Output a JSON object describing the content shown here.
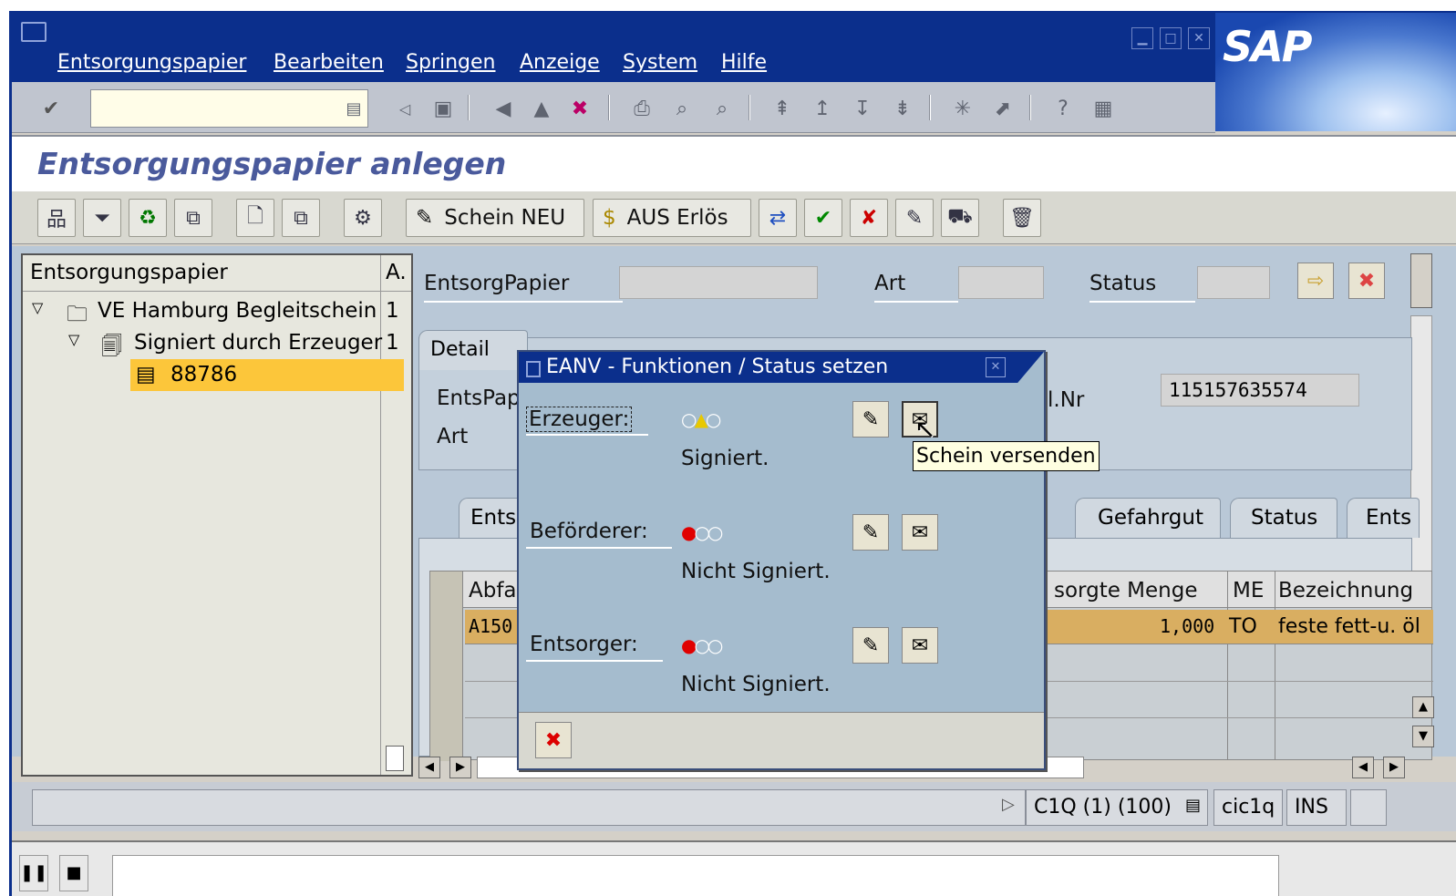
{
  "menu": {
    "items": [
      "Entsorgungspapier",
      "Bearbeiten",
      "Springen",
      "Anzeige",
      "System",
      "Hilfe"
    ]
  },
  "logo": "SAP",
  "page": {
    "title": "Entsorgungspapier anlegen"
  },
  "apptoolbar": {
    "schein_neu": "Schein NEU",
    "aus_erloes": "AUS Erlös"
  },
  "tree": {
    "header": "Entsorgungspapier",
    "header_col2": "A.",
    "rows": [
      {
        "label": "VE Hamburg Begleitschein",
        "count": "1"
      },
      {
        "label": "Signiert durch Erzeuger",
        "count": "1"
      },
      {
        "label": "88786",
        "count": ""
      }
    ]
  },
  "form": {
    "entsorgpapier_label": "EntsorgPapier",
    "art_label": "Art",
    "status_label": "Status",
    "detail_tab": "Detail",
    "entspap_label": "EntsPap",
    "art2_label": "Art",
    "nr_label": "l.Nr",
    "nr_value": "115157635574"
  },
  "tabs": [
    "Ents",
    "Gefahrgut",
    "Status",
    "Ents"
  ],
  "grid": {
    "col_abfall": "Abfal",
    "col_menge": "sorgte Menge",
    "col_me": "ME",
    "col_bez": "Bezeichnung",
    "row1": {
      "abfall": "A150",
      "menge": "1,000",
      "me": "TO",
      "bez": "feste fett-u. öl"
    }
  },
  "dialog": {
    "title": "EANV - Funktionen / Status setzen",
    "parties": [
      {
        "label": "Erzeuger:",
        "status": "Signiert."
      },
      {
        "label": "Beförderer:",
        "status": "Nicht Signiert."
      },
      {
        "label": "Entsorger:",
        "status": "Nicht Signiert."
      }
    ]
  },
  "tooltip": "Schein versenden",
  "status": {
    "system": "C1Q (1) (100)",
    "host": "cic1q",
    "mode": "INS"
  }
}
